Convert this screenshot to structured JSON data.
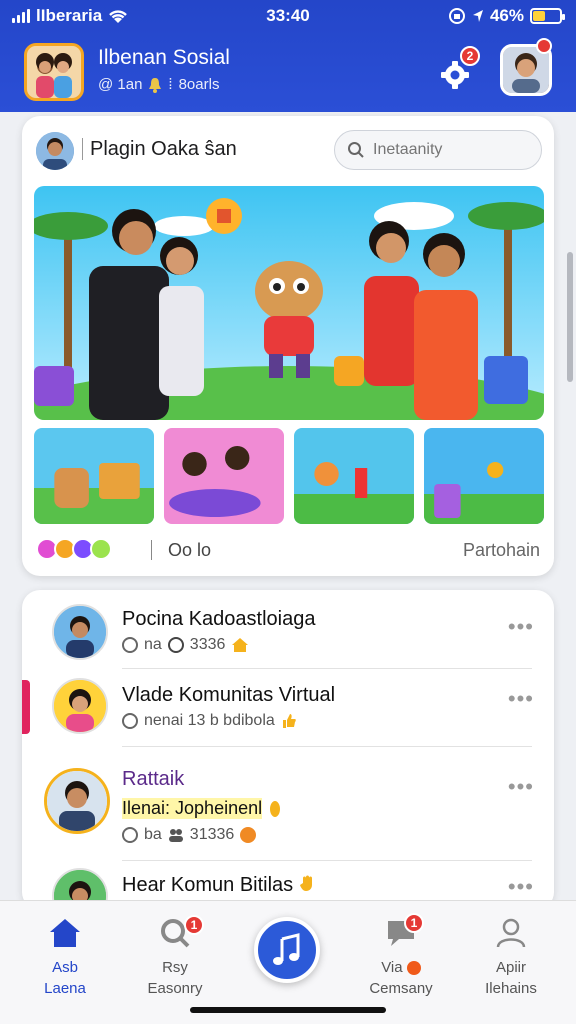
{
  "status_bar": {
    "carrier": "lIberaria",
    "time": "33:40",
    "battery_text": "46%",
    "battery_level": 0.46,
    "colors": {
      "battery_fill": "#ffd23a"
    }
  },
  "header": {
    "app_name": "Ilbenan Sosial",
    "subtitle": "@ 1an",
    "subtitle_extra": "8oarls",
    "settings_badge": "2",
    "colors": {
      "bar": "#2446c9",
      "badge": "#e53935"
    }
  },
  "feed_card": {
    "title": "Plagin Oaka ŝan",
    "search_placeholder": "Inetaanity",
    "footer_left": "Oo lo",
    "footer_right": "Partohain",
    "reaction_colors": [
      "#e14dd3",
      "#f5a623",
      "#7c4dff",
      "#9be34d"
    ]
  },
  "list": {
    "items": [
      {
        "name": "Pocina Kadoastloiaga",
        "meta": "na",
        "count": "3336",
        "icon": "home-icon"
      },
      {
        "name": "Vlade Komunitas Virtual",
        "meta": "nenai 13 b bdibola",
        "icon": "thumb-icon",
        "accent": true
      },
      {
        "name": "Rattaik",
        "highlight": "Ilenai: Jopheinenl",
        "meta": "ba",
        "count": "31336",
        "icon": "coin-icon"
      },
      {
        "name": "Hear Komun Bitilas",
        "icon": "hand-icon"
      }
    ],
    "more_label": "•••"
  },
  "bottom_nav": {
    "items": [
      {
        "line1": "Asb",
        "line2": "Laena",
        "icon": "home-icon",
        "active": true
      },
      {
        "line1": "Rsy",
        "line2": "Easonry",
        "icon": "search-icon",
        "badge": "1"
      },
      {
        "line1": "",
        "line2": "",
        "icon": "music-note-icon",
        "center": true
      },
      {
        "line1": "Via",
        "line2": "Cemsany",
        "icon": "chat-icon",
        "badge": "1"
      },
      {
        "line1": "Apiir",
        "line2": "Ilehains",
        "icon": "user-icon"
      }
    ],
    "colors": {
      "active": "#2446c9",
      "center": "#2c5ad8"
    }
  }
}
